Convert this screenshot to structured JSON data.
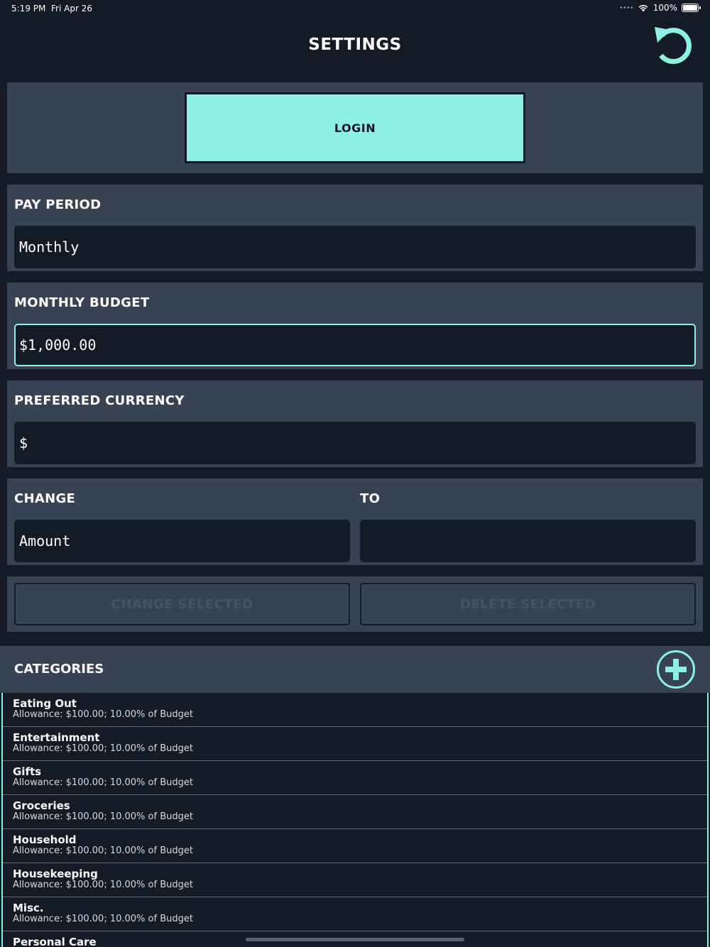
{
  "status_bar": {
    "time": "5:19 PM",
    "date": "Fri Apr 26",
    "battery": "100%"
  },
  "header": {
    "title": "SETTINGS"
  },
  "login": {
    "label": "LOGIN"
  },
  "pay_period": {
    "label": "PAY PERIOD",
    "value": "Monthly"
  },
  "monthly_budget": {
    "label": "MONTHLY BUDGET",
    "value": "$1,000.00"
  },
  "currency": {
    "label": "PREFERRED CURRENCY",
    "value": "$"
  },
  "change": {
    "label": "CHANGE",
    "to_label": "TO",
    "value": "Amount",
    "to_value": ""
  },
  "actions": {
    "change_selected": "CHANGE SELECTED",
    "delete_selected": "DELETE SELECTED"
  },
  "categories": {
    "title": "CATEGORIES",
    "items": [
      {
        "name": "Eating Out",
        "detail": "Allowance: $100.00; 10.00% of Budget"
      },
      {
        "name": "Entertainment",
        "detail": "Allowance: $100.00; 10.00% of Budget"
      },
      {
        "name": "Gifts",
        "detail": "Allowance: $100.00; 10.00% of Budget"
      },
      {
        "name": "Groceries",
        "detail": "Allowance: $100.00; 10.00% of Budget"
      },
      {
        "name": "Household",
        "detail": "Allowance: $100.00; 10.00% of Budget"
      },
      {
        "name": "Housekeeping",
        "detail": "Allowance: $100.00; 10.00% of Budget"
      },
      {
        "name": "Misc.",
        "detail": "Allowance: $100.00; 10.00% of Budget"
      },
      {
        "name": "Personal Care",
        "detail": ""
      }
    ]
  },
  "colors": {
    "background": "#141b26",
    "panel": "#374252",
    "accent": "#8df0e2",
    "disabled_text": "#475262"
  },
  "icons": {
    "refresh": "refresh-icon",
    "add": "plus-circle-icon",
    "wifi": "wifi-icon",
    "battery": "battery-icon"
  }
}
